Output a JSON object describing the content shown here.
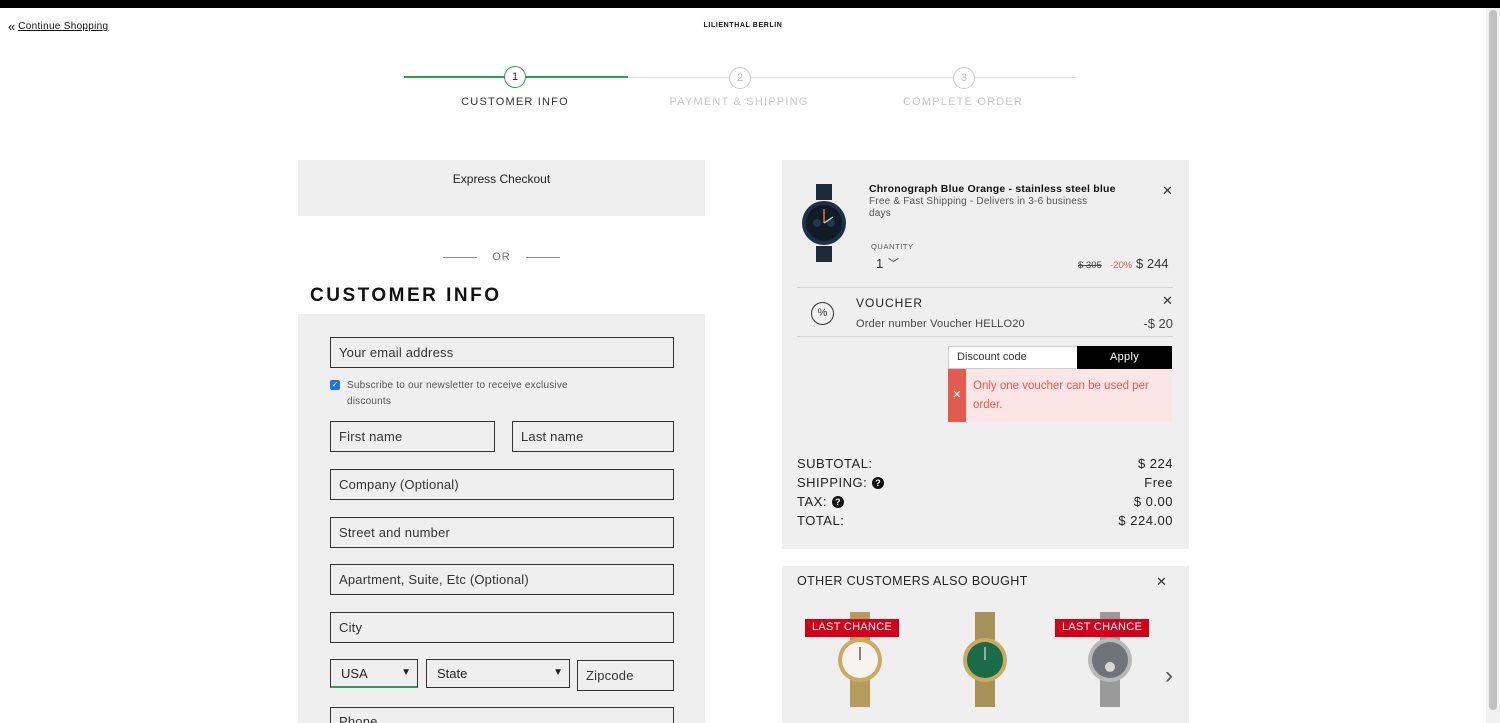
{
  "header": {
    "continue_label": "Continue Shopping",
    "brand": "LILIENTHAL BERLIN"
  },
  "steps": [
    {
      "number": "1",
      "label": "CUSTOMER INFO",
      "active": true
    },
    {
      "number": "2",
      "label": "PAYMENT & SHIPPING",
      "active": false
    },
    {
      "number": "3",
      "label": "COMPLETE ORDER",
      "active": false
    }
  ],
  "express": {
    "label": "Express Checkout"
  },
  "or_label": "OR",
  "customer_info": {
    "title": "CUSTOMER INFO",
    "email_placeholder": "Your email address",
    "newsletter_label": "Subscribe to our newsletter to receive exclusive discounts",
    "newsletter_checked": true,
    "first_name_placeholder": "First name",
    "last_name_placeholder": "Last name",
    "company_placeholder": "Company (Optional)",
    "street_placeholder": "Street and number",
    "apartment_placeholder": "Apartment, Suite, Etc (Optional)",
    "city_placeholder": "City",
    "country_selected": "USA",
    "state_selected": "State",
    "zipcode_placeholder": "Zipcode",
    "phone_placeholder": "Phone"
  },
  "cart": {
    "product": {
      "title": "Chronograph Blue Orange - stainless steel blue",
      "shipping": "Free & Fast Shipping - Delivers in 3-6 business days",
      "quantity_label": "QUANTITY",
      "quantity": "1",
      "price_old": "$ 305",
      "discount": "-20%",
      "price": "$ 244"
    },
    "voucher": {
      "title": "VOUCHER",
      "subtitle": "Order number Voucher HELLO20",
      "amount": "-$ 20",
      "icon_text": "%"
    },
    "discount_placeholder": "Discount code",
    "apply_label": "Apply",
    "error_message": "Only one voucher can be used per order.",
    "totals": {
      "subtotal_label": "SUBTOTAL:",
      "subtotal_value": "$ 224",
      "shipping_label": "SHIPPING:",
      "shipping_value": "Free",
      "tax_label": "TAX:",
      "tax_value": "$ 0.00",
      "total_label": "TOTAL:",
      "total_value": "$ 224.00"
    }
  },
  "upsell": {
    "title": "OTHER CUSTOMERS ALSO BOUGHT",
    "badges": [
      "LAST CHANCE",
      "LAST CHANCE"
    ]
  },
  "colors": {
    "accent_green": "#2e9b57",
    "error_red": "#e35a4e",
    "badge_red": "#d0021b"
  }
}
